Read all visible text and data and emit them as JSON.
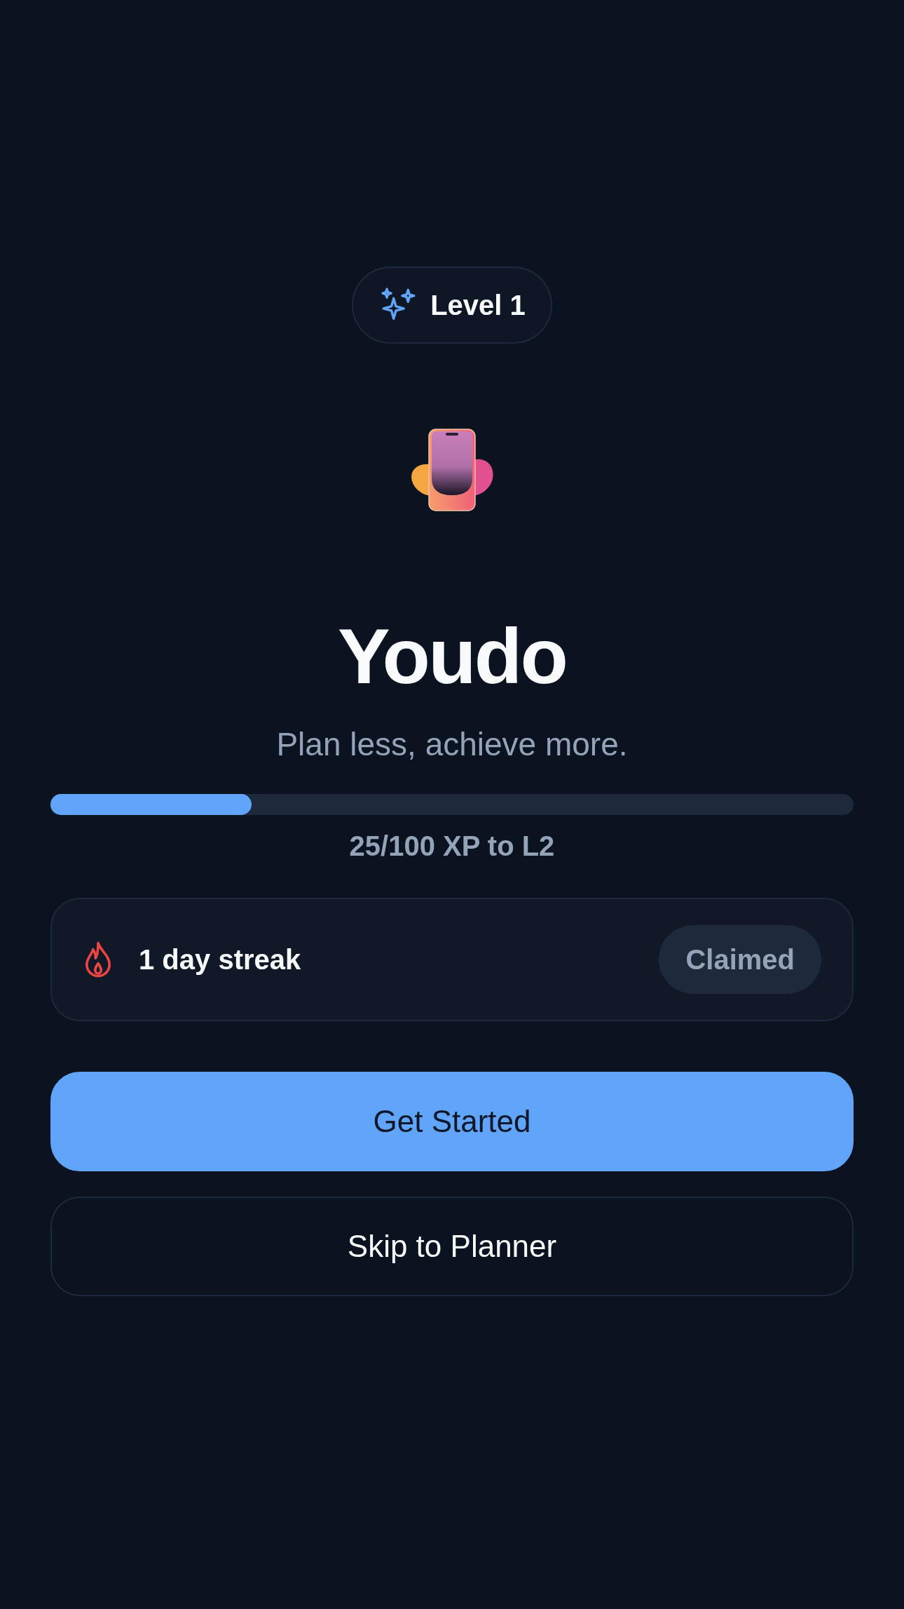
{
  "badge": {
    "label": "Level 1"
  },
  "title": "Youdo",
  "tagline": "Plan less, achieve more.",
  "xp": {
    "level": 0.25,
    "label": "25/100 XP to L2"
  },
  "streak": {
    "label": "1 day streak",
    "status": "Claimed"
  },
  "buttons": [
    {
      "label": "Get Started",
      "kind": "primary"
    },
    {
      "label": "Skip to Planner",
      "kind": "outline"
    }
  ]
}
